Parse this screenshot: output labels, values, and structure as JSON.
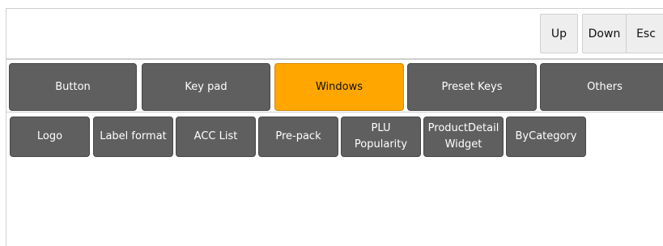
{
  "toolbar": {
    "up_label": "Up",
    "down_label": "Down",
    "esc_label": "Esc"
  },
  "categories": [
    {
      "label": "Button",
      "active": false
    },
    {
      "label": "Key pad",
      "active": false
    },
    {
      "label": "Windows",
      "active": true
    },
    {
      "label": "Preset Keys",
      "active": false
    },
    {
      "label": "Others",
      "active": false
    }
  ],
  "windows_items": [
    {
      "label": "Logo"
    },
    {
      "label": "Label format"
    },
    {
      "label": "ACC List"
    },
    {
      "label": "Pre-pack"
    },
    {
      "label": "PLU Popularity"
    },
    {
      "label": "ProductDetail Widget"
    },
    {
      "label": "ByCategory"
    }
  ],
  "colors": {
    "button_bg": "#5f5f5f",
    "active_bg": "#ffa600",
    "nav_bg": "#eeeeee"
  }
}
